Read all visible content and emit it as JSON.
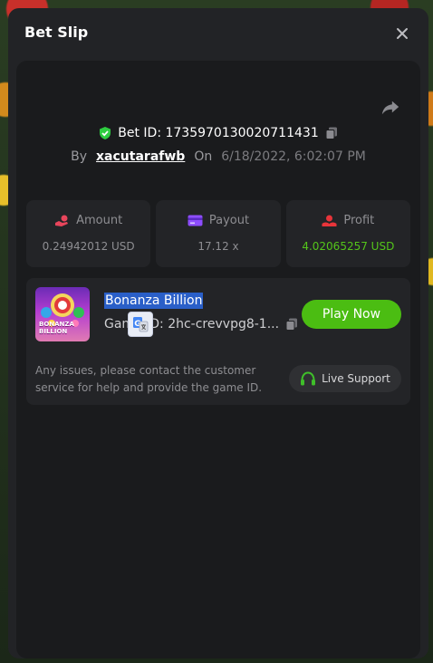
{
  "modal": {
    "title": "Bet Slip",
    "close_icon": "close-icon",
    "share_icon": "share-icon"
  },
  "bet": {
    "id_label": "Bet ID: 1735970130020711431",
    "by_label": "By",
    "username": "xacutarafwb",
    "on_label": "On",
    "datetime": "6/18/2022, 6:02:07 PM"
  },
  "stats": {
    "amount": {
      "label": "Amount",
      "value": "0.24942012 USD",
      "icon": "hand-coins-icon"
    },
    "payout": {
      "label": "Payout",
      "value": "17.12 x",
      "icon": "card-icon"
    },
    "profit": {
      "label": "Profit",
      "value": "4.02065257 USD",
      "icon": "profit-icon"
    }
  },
  "game": {
    "name": "Bonanza Billion",
    "id_text": "Game ID: 2hc-crevvpg8-1...",
    "thumb_text": "BONANZA BILLION",
    "play_label": "Play Now"
  },
  "support": {
    "message": "Any issues, please contact the customer service for help and provide the game ID.",
    "button_label": "Live Support"
  },
  "colors": {
    "accent_green": "#4bbd12",
    "profit_green": "#54c51a",
    "shield_green": "#2ecc40",
    "amount_icon": "#e8455b",
    "payout_icon": "#8e4dff",
    "profit_icon": "#e8343a"
  }
}
